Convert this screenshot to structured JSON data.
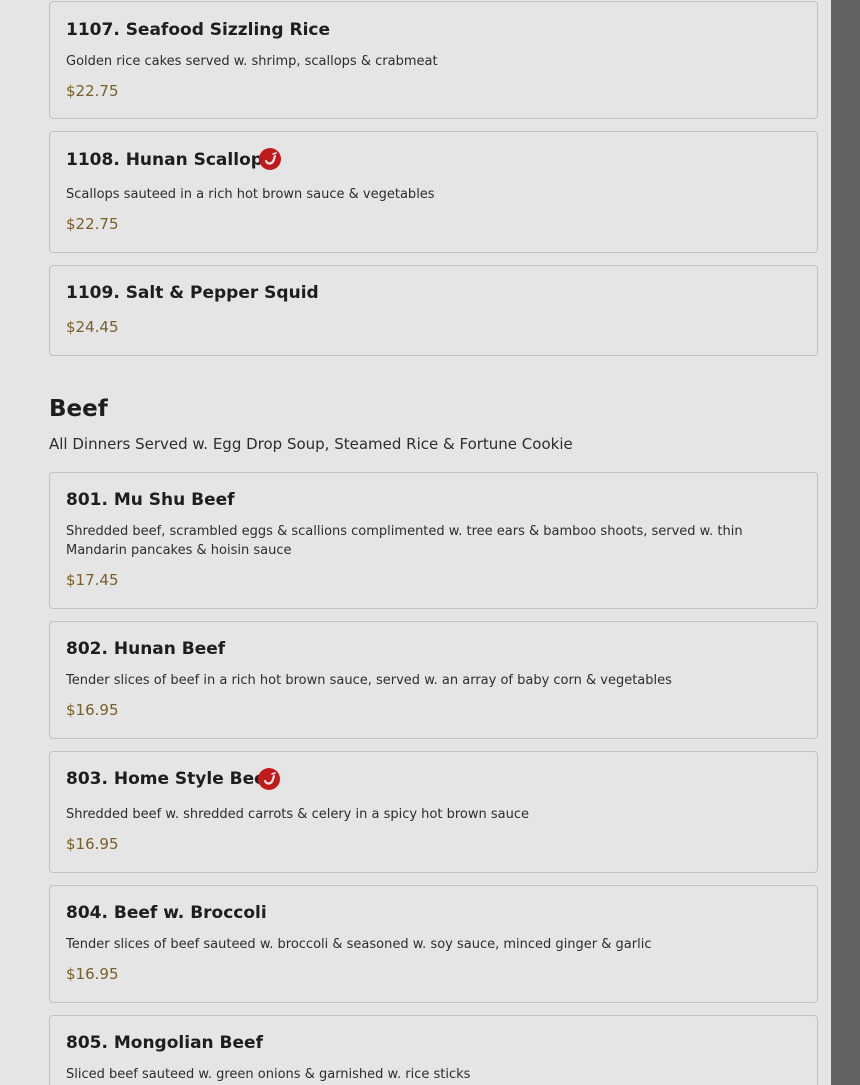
{
  "items": [
    {
      "title": "1107. Seafood Sizzling Rice",
      "desc": "Golden rice cakes served w. shrimp, scallops & crabmeat",
      "price": "$22.75"
    },
    {
      "title": "1108. Hunan Scallops",
      "desc": "Scallops sauteed in a rich hot brown sauce & vegetables",
      "price": "$22.75",
      "icon": "chili-pepper-icon"
    },
    {
      "title": "1109. Salt & Pepper Squid",
      "price": "$24.45"
    },
    {
      "title": "801. Mu Shu Beef",
      "desc": "Shredded beef, scrambled eggs & scallions complimented w. tree ears & bamboo shoots, served w. thin Mandarin pancakes & hoisin sauce",
      "price": "$17.45"
    },
    {
      "title": "802. Hunan Beef",
      "desc": "Tender slices of beef in a rich hot brown sauce, served w. an array of baby corn & vegetables",
      "price": "$16.95"
    },
    {
      "title": "803. Home Style Beef",
      "desc": "Shredded beef w. shredded carrots & celery in a spicy hot brown sauce",
      "price": "$16.95",
      "icon": "chili-pepper-icon"
    },
    {
      "title": "804. Beef w. Broccoli",
      "desc": "Tender slices of beef sauteed w. broccoli & seasoned w. soy sauce, minced ginger & garlic",
      "price": "$16.95"
    },
    {
      "title": "805. Mongolian Beef",
      "desc": "Sliced beef sauteed w. green onions & garnished w. rice sticks"
    }
  ],
  "section": {
    "title": "Beef",
    "subtitle": "All Dinners Served w. Egg Drop Soup, Steamed Rice & Fortune Cookie"
  },
  "colors": {
    "price": "#8a6a2c",
    "spicy_icon": "#d71e1e"
  }
}
